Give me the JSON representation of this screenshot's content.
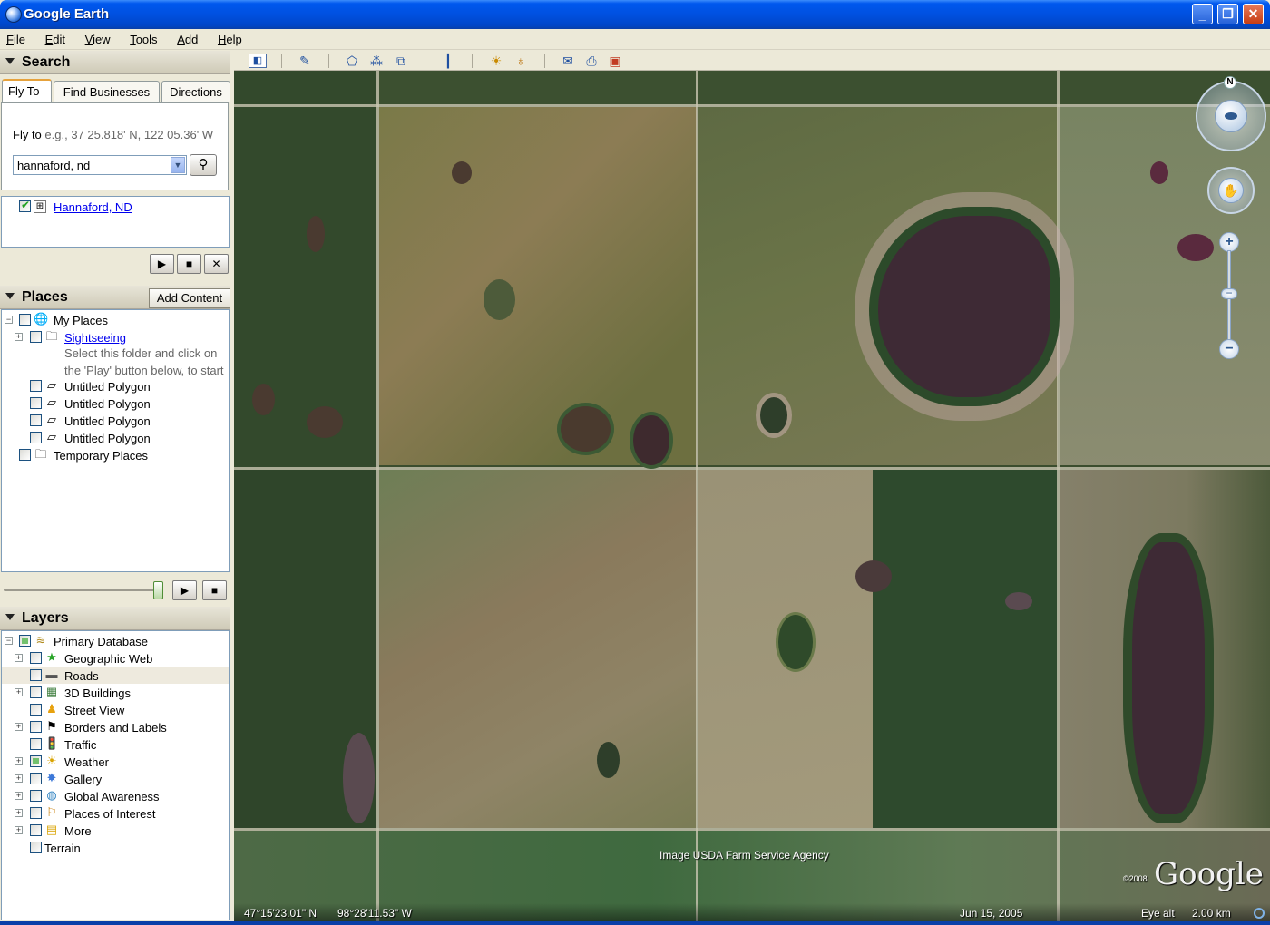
{
  "window": {
    "title": "Google Earth",
    "minimize": "_",
    "maximize": "❐",
    "close": "✕"
  },
  "menu": [
    "File",
    "Edit",
    "View",
    "Tools",
    "Add",
    "Help"
  ],
  "search": {
    "header": "Search",
    "tabs": [
      "Fly To",
      "Find Businesses",
      "Directions"
    ],
    "fly_to_label": "Fly to",
    "fly_to_hint": "e.g., 37 25.818' N, 122 05.36' W",
    "input_value": "hannaford, nd",
    "result_label": "Hannaford, ND"
  },
  "places": {
    "header": "Places",
    "add_content": "Add Content",
    "items": {
      "my_places": "My Places",
      "sightseeing": "Sightseeing",
      "sightseeing_hint_1": "Select this folder and click on",
      "sightseeing_hint_2": "the 'Play' button below, to start",
      "poly1": "Untitled Polygon",
      "poly2": "Untitled Polygon",
      "poly3": "Untitled Polygon",
      "poly4": "Untitled Polygon",
      "temporary": "Temporary Places"
    },
    "tour_slider": 1.0
  },
  "layers": {
    "header": "Layers",
    "items": [
      "Primary Database",
      "Geographic Web",
      "Roads",
      "3D Buildings",
      "Street View",
      "Borders and Labels",
      "Traffic",
      "Weather",
      "Gallery",
      "Global Awareness",
      "Places of Interest",
      "More",
      "Terrain"
    ]
  },
  "map": {
    "credit": "Image USDA Farm Service Agency",
    "copyright_year": "©2008",
    "logo": "Google",
    "lat": "47°15'23.01\" N",
    "lon": "98°28'11.53\" W",
    "date": "Jun 15, 2005",
    "eye_alt_label": "Eye alt",
    "eye_alt_value": "2.00 km",
    "compass_n": "N"
  },
  "controls": {
    "play": "▶",
    "stop": "■",
    "clear": "✕",
    "search_go": "⚲"
  }
}
